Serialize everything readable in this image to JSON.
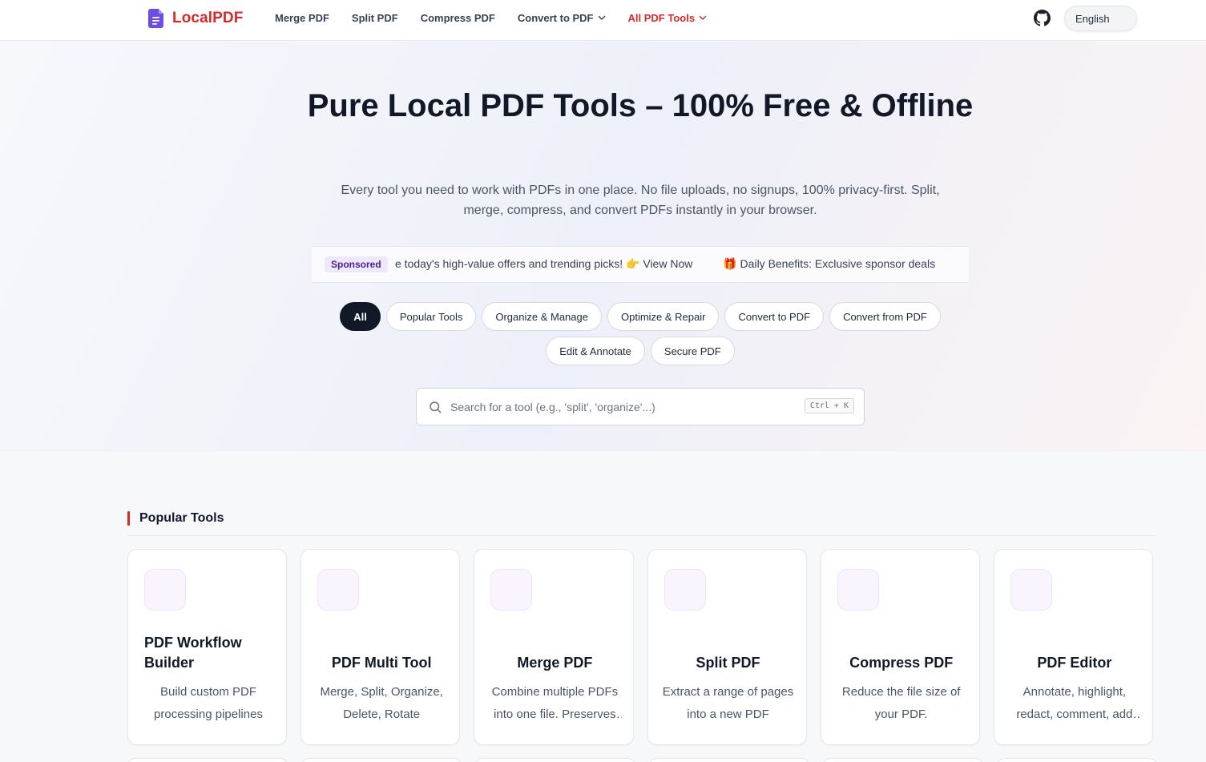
{
  "brand": {
    "name": "LocalPDF",
    "accent": "#d42a2a"
  },
  "nav": {
    "items": [
      {
        "label": "Merge PDF",
        "dropdown": false,
        "active": false
      },
      {
        "label": "Split PDF",
        "dropdown": false,
        "active": false
      },
      {
        "label": "Compress PDF",
        "dropdown": false,
        "active": false
      },
      {
        "label": "Convert to PDF",
        "dropdown": true,
        "active": false
      },
      {
        "label": "All PDF Tools",
        "dropdown": true,
        "active": true
      }
    ],
    "language": "English"
  },
  "hero": {
    "title": "Pure Local PDF Tools – 100% Free & Offline",
    "subtitle": "Every tool you need to work with PDFs in one place. No file uploads, no signups, 100% privacy-first. Split, merge, compress, and convert PDFs instantly in your browser."
  },
  "sponsor": {
    "badge": "Sponsored",
    "messages": [
      "e today's high-value offers and trending picks! 👉 View Now",
      "🎁 Daily Benefits: Exclusive sponsor deals"
    ]
  },
  "categories": [
    {
      "label": "All",
      "active": true
    },
    {
      "label": "Popular Tools",
      "active": false
    },
    {
      "label": "Organize & Manage",
      "active": false
    },
    {
      "label": "Optimize & Repair",
      "active": false
    },
    {
      "label": "Convert to PDF",
      "active": false
    },
    {
      "label": "Convert from PDF",
      "active": false
    },
    {
      "label": "Edit & Annotate",
      "active": false
    },
    {
      "label": "Secure PDF",
      "active": false
    }
  ],
  "search": {
    "placeholder": "Search for a tool (e.g., 'split', 'organize'...)",
    "value": "",
    "shortcut": "Ctrl + K"
  },
  "popular": {
    "title": "Popular Tools",
    "tools": [
      {
        "title": "PDF Workflow Builder",
        "desc": "Build custom PDF processing pipelines"
      },
      {
        "title": "PDF Multi Tool",
        "desc": "Merge, Split, Organize, Delete, Rotate"
      },
      {
        "title": "Merge PDF",
        "desc": "Combine multiple PDFs into one file. Preserves bookmarks."
      },
      {
        "title": "Split PDF",
        "desc": "Extract a range of pages into a new PDF"
      },
      {
        "title": "Compress PDF",
        "desc": "Reduce the file size of your PDF."
      },
      {
        "title": "PDF Editor",
        "desc": "Annotate, highlight, redact, comment, add shapes"
      }
    ]
  }
}
